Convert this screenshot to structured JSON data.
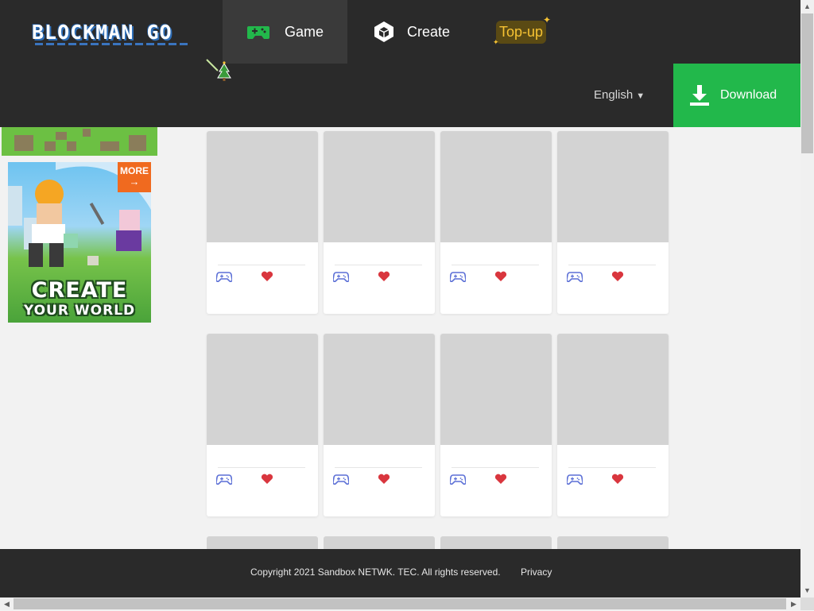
{
  "header": {
    "logo_text": "BLOCKMAN GO",
    "nav": [
      {
        "label": "Game",
        "icon": "gamepad-icon",
        "active": true
      },
      {
        "label": "Create",
        "icon": "cube-icon"
      },
      {
        "label": "Top-up",
        "icon": "sparkle-icon"
      }
    ],
    "language": "English",
    "download_label": "Download"
  },
  "promo": {
    "more_label": "MORE",
    "title_line1": "CREATE",
    "title_line2": "YOUR WORLD"
  },
  "cards": {
    "rows_visible": 2,
    "per_row": 4,
    "items": [
      {
        "id": 1
      },
      {
        "id": 2
      },
      {
        "id": 3
      },
      {
        "id": 4
      },
      {
        "id": 5
      },
      {
        "id": 6
      },
      {
        "id": 7
      },
      {
        "id": 8
      }
    ]
  },
  "footer": {
    "copyright": "Copyright 2021 Sandbox NETWK. TEC. All rights reserved.",
    "privacy_label": "Privacy"
  },
  "colors": {
    "header_bg": "#2a2a2a",
    "accent_green": "#22b84b",
    "topup_gold": "#f6c233",
    "heart_red": "#d9363e",
    "controller_blue": "#5b6fd6",
    "placeholder_gray": "#d3d3d3"
  }
}
